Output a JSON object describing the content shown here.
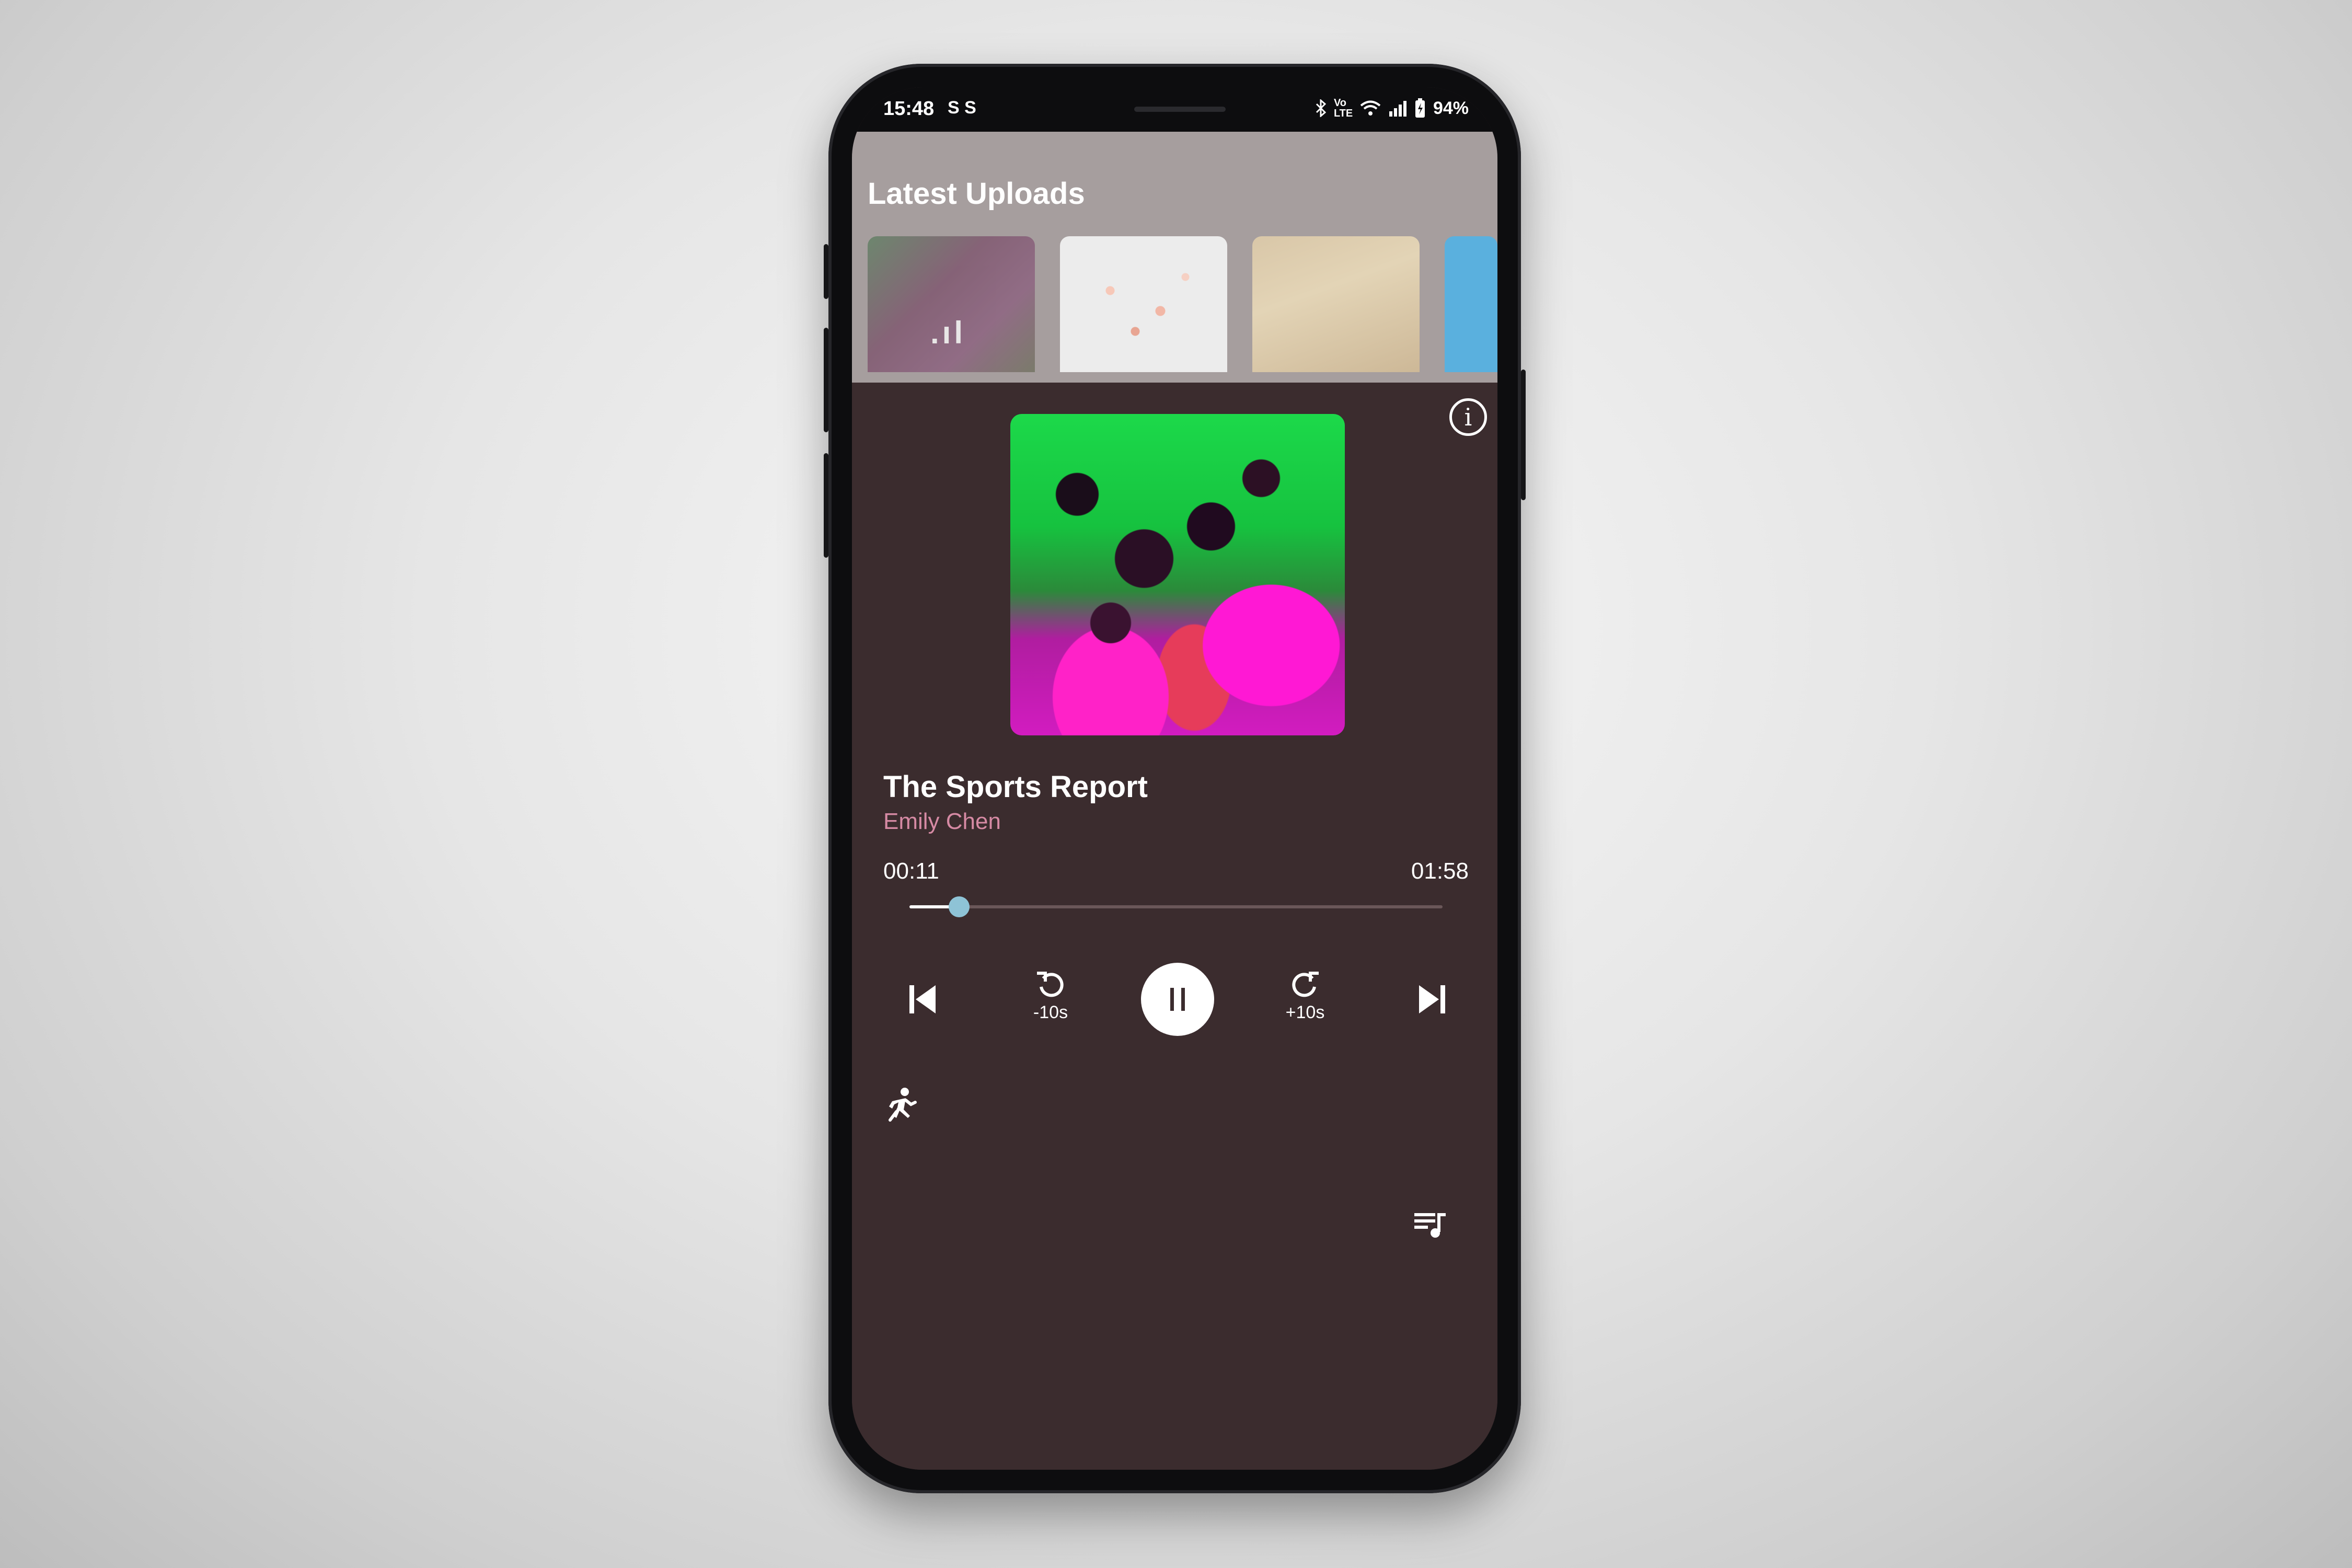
{
  "status_bar": {
    "time": "15:48",
    "notifications": "S  S",
    "network": "Vo LTE",
    "battery": "94%"
  },
  "home": {
    "section_title": "Latest Uploads",
    "thumbnails": [
      {
        "name": "marble-art-thumbnail",
        "playing": true
      },
      {
        "name": "pills-thumbnail"
      },
      {
        "name": "desk-items-thumbnail"
      },
      {
        "name": "blue-partial-thumbnail"
      }
    ]
  },
  "player": {
    "title": "The Sports Report",
    "artist": "Emily Chen",
    "elapsed": "00:11",
    "duration": "01:58",
    "progress": 0.093,
    "rewind_label": "-10s",
    "forward_label": "+10s",
    "state": "playing"
  },
  "colors": {
    "player_background": "#3b2c2e",
    "artist_text": "#d68aa4",
    "seek_thumb": "#8ec3d6",
    "accent_white": "#ffffff"
  },
  "icons": {
    "info": "info-icon",
    "previous": "skip-previous-icon",
    "rewind": "replay-10-icon",
    "pause": "pause-icon",
    "forward": "forward-10-icon",
    "next": "skip-next-icon",
    "speed": "running-person-icon",
    "queue": "queue-music-icon"
  }
}
